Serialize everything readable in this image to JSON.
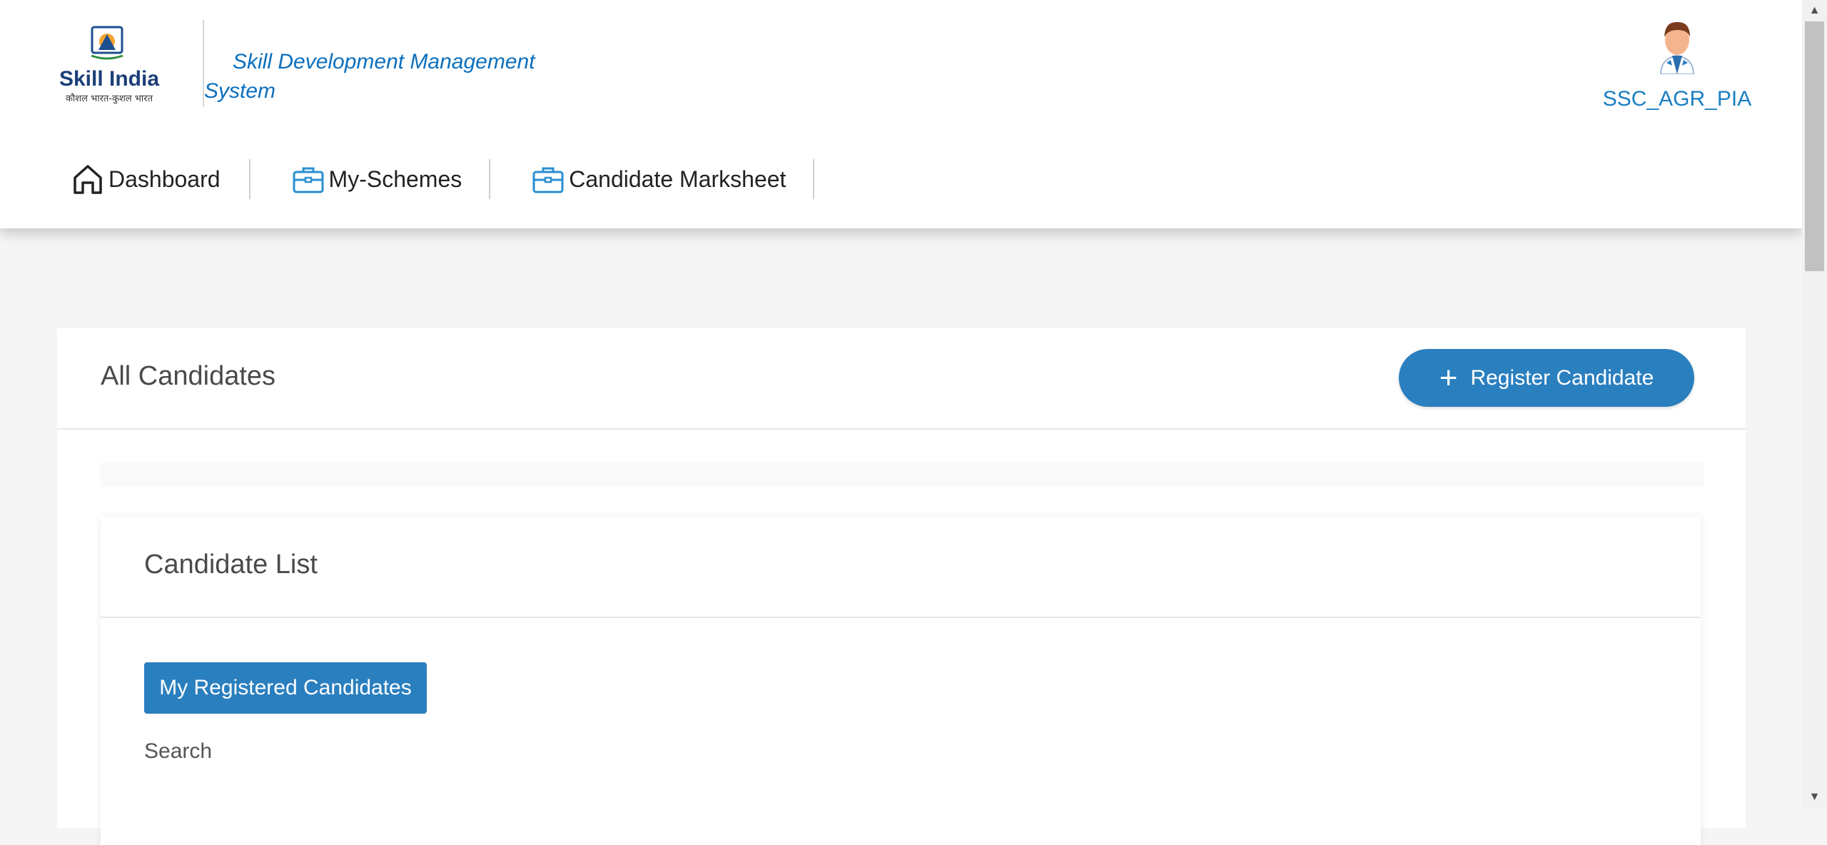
{
  "header": {
    "logo_text": "Skill India",
    "logo_subtext": "कौशल भारत-कुशल भारत",
    "system_title": "Skill Development Management System",
    "username": "SSC_AGR_PIA"
  },
  "nav": {
    "items": [
      {
        "label": "Dashboard",
        "icon": "home-icon"
      },
      {
        "label": "My-Schemes",
        "icon": "briefcase-icon"
      },
      {
        "label": "Candidate Marksheet",
        "icon": "briefcase-icon"
      }
    ]
  },
  "main": {
    "title": "All Candidates",
    "register_button": "Register Candidate",
    "list_card": {
      "title": "Candidate List",
      "my_candidates_button": "My Registered Candidates",
      "search_label": "Search"
    }
  },
  "colors": {
    "primary": "#2a7fbf",
    "link": "#0b6fbd"
  }
}
